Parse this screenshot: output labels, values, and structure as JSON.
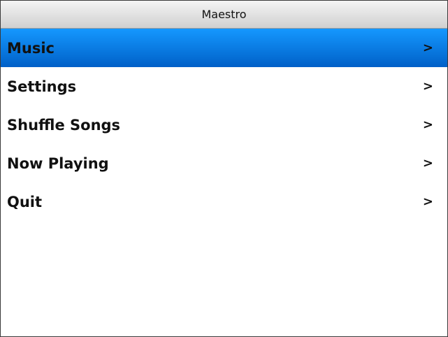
{
  "app": {
    "title": "Maestro"
  },
  "menu": {
    "selected_index": 0,
    "selected_color": "#0a7fea",
    "chevron_glyph": ">",
    "items": [
      {
        "label": "Music"
      },
      {
        "label": "Settings"
      },
      {
        "label": "Shuffle Songs"
      },
      {
        "label": "Now Playing"
      },
      {
        "label": "Quit"
      }
    ]
  }
}
